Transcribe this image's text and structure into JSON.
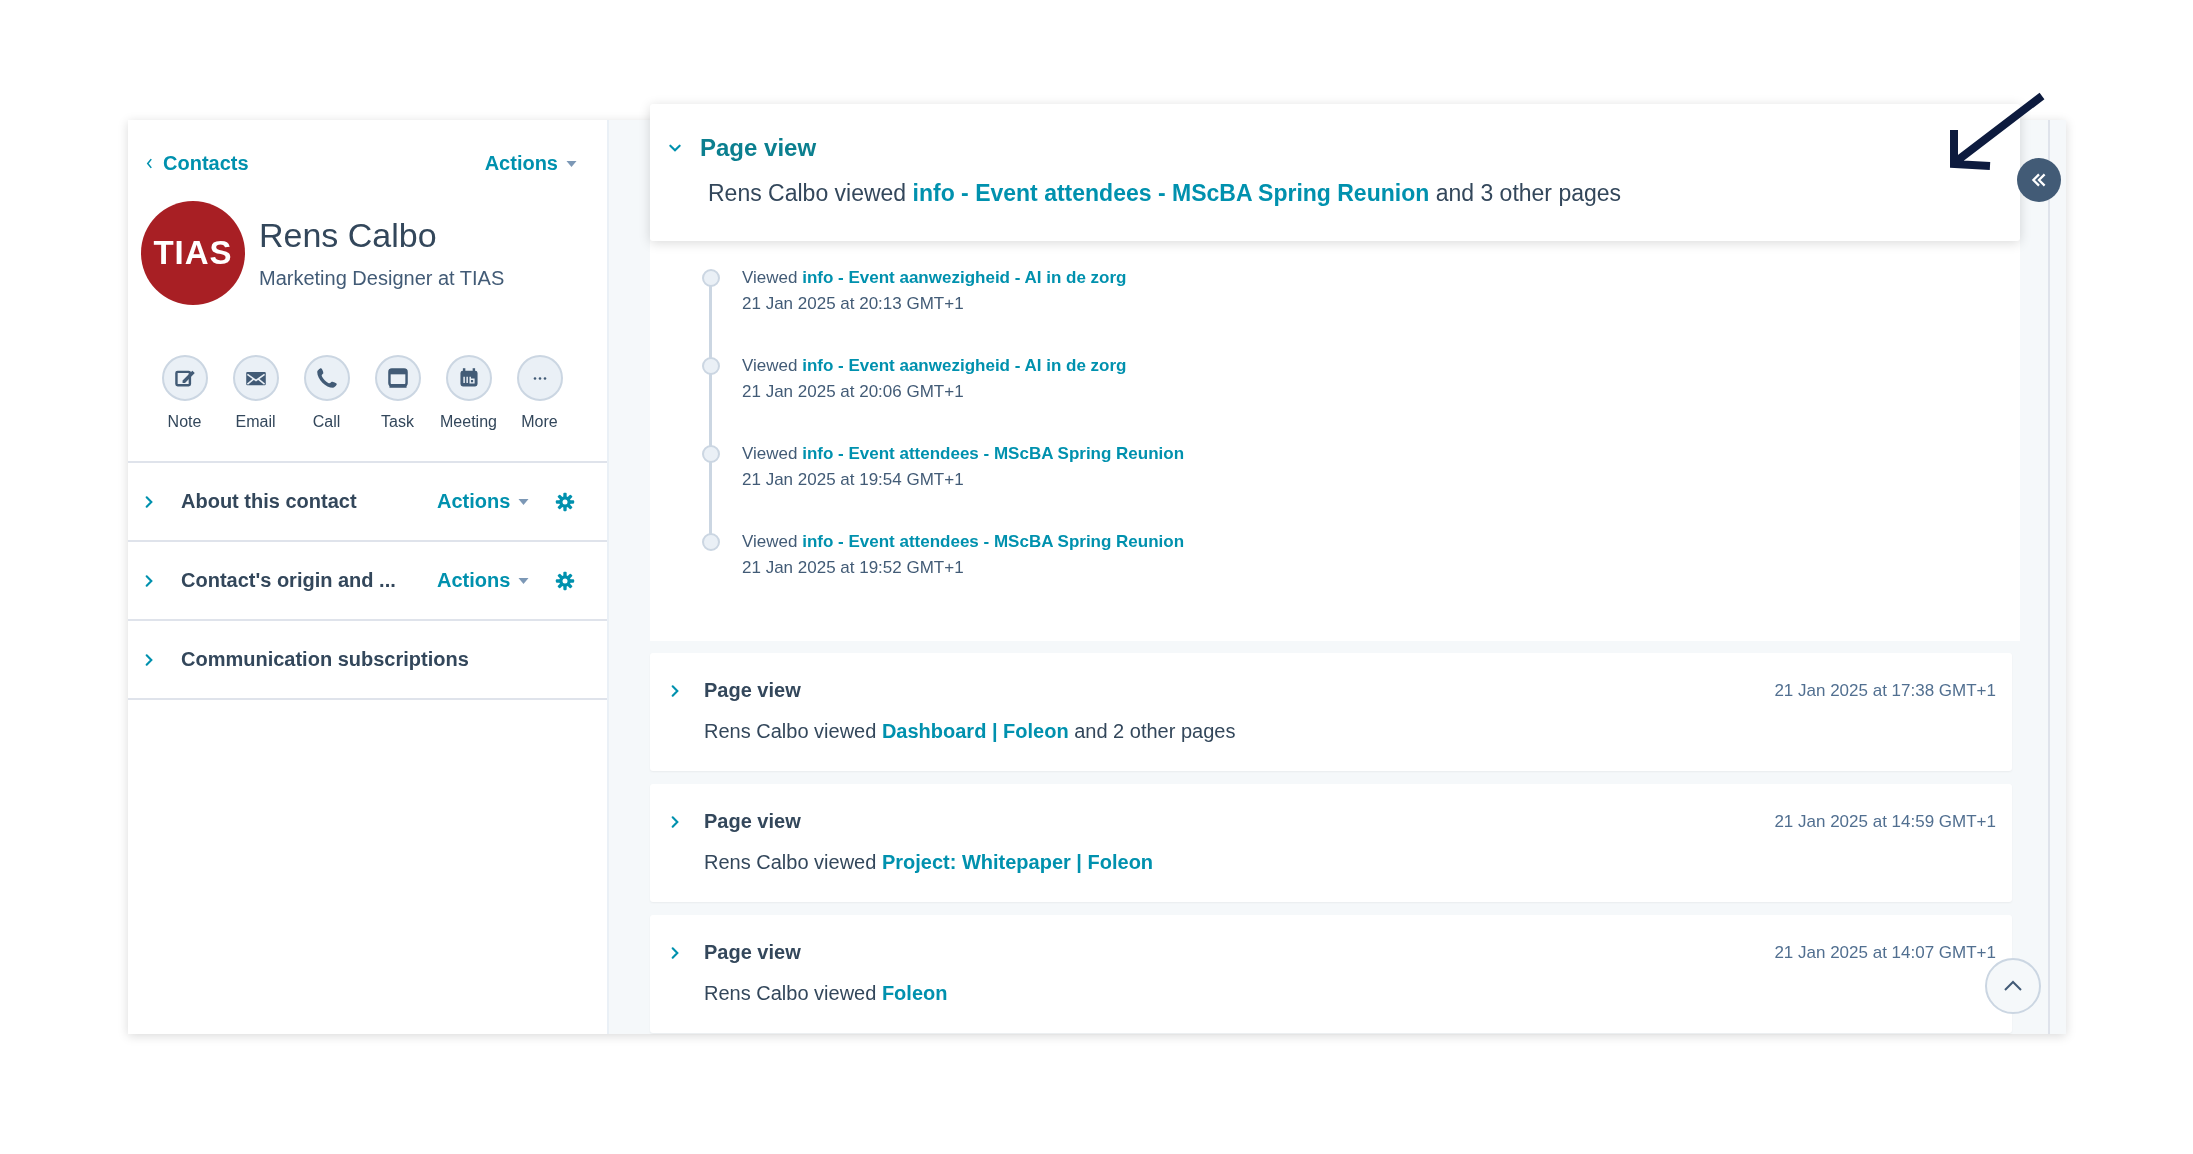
{
  "back_link": "Contacts",
  "header_actions": "Actions",
  "contact": {
    "initials": "TIAS",
    "name": "Rens Calbo",
    "title": "Marketing Designer at TIAS"
  },
  "quick_actions": [
    {
      "label": "Note",
      "kind": "note"
    },
    {
      "label": "Email",
      "kind": "email"
    },
    {
      "label": "Call",
      "kind": "call"
    },
    {
      "label": "Task",
      "kind": "task"
    },
    {
      "label": "Meeting",
      "kind": "meeting"
    },
    {
      "label": "More",
      "kind": "more"
    }
  ],
  "sections": [
    {
      "title": "About this contact",
      "actions": "Actions",
      "expanded": false
    },
    {
      "title": "Contact's origin and ...",
      "actions": "Actions",
      "expanded": false
    },
    {
      "title": "Communication subscriptions",
      "expanded": false
    }
  ],
  "activities": [
    {
      "title": "Page view",
      "expanded": true,
      "actor": "Rens Calbo viewed",
      "link": "info - Event attendees - MScBA Spring Reunion",
      "suffix": "and 3 other pages",
      "entries": [
        {
          "verb": "Viewed",
          "link": "info - Event aanwezigheid - AI in de zorg",
          "time": "21 Jan 2025 at 20:13 GMT+1"
        },
        {
          "verb": "Viewed",
          "link": "info - Event aanwezigheid - AI in de zorg",
          "time": "21 Jan 2025 at 20:06 GMT+1"
        },
        {
          "verb": "Viewed",
          "link": "info - Event attendees - MScBA Spring Reunion",
          "time": "21 Jan 2025 at 19:54 GMT+1"
        },
        {
          "verb": "Viewed",
          "link": "info - Event attendees - MScBA Spring Reunion",
          "time": "21 Jan 2025 at 19:52 GMT+1"
        }
      ]
    },
    {
      "title": "Page view",
      "expanded": false,
      "timestamp": "21 Jan 2025 at 17:38 GMT+1",
      "actor": "Rens Calbo viewed",
      "link": "Dashboard | Foleon",
      "suffix": "and 2 other pages"
    },
    {
      "title": "Page view",
      "expanded": false,
      "timestamp": "21 Jan 2025 at 14:59 GMT+1",
      "actor": "Rens Calbo viewed",
      "link": "Project: Whitepaper | Foleon"
    },
    {
      "title": "Page view",
      "expanded": false,
      "timestamp": "21 Jan 2025 at 14:07 GMT+1",
      "actor": "Rens Calbo viewed",
      "link": "Foleon"
    }
  ]
}
